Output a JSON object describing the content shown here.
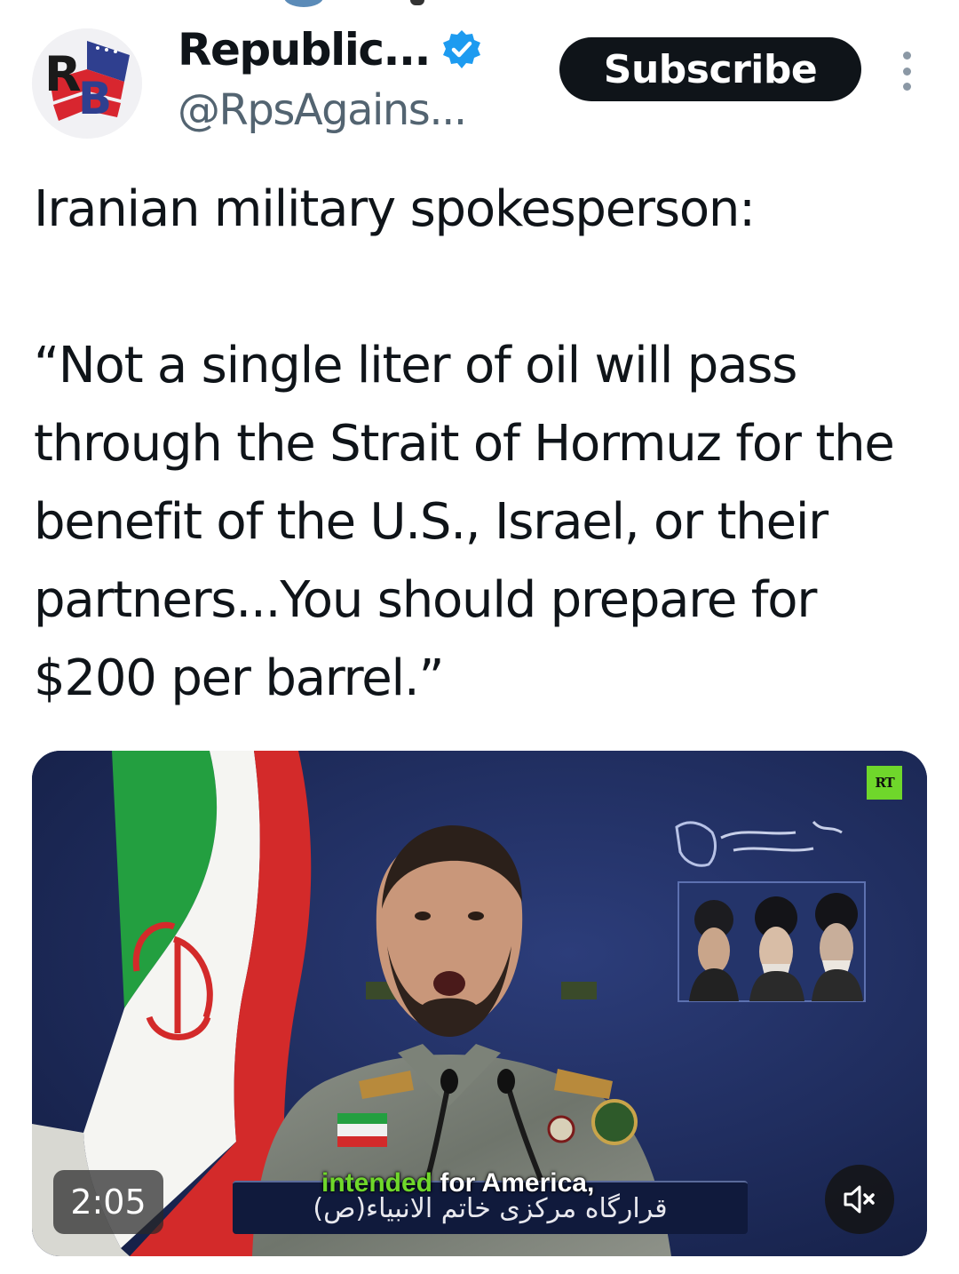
{
  "account": {
    "display_name": "Republic...",
    "handle": "@RpsAgains...",
    "avatar_letters": "RB",
    "subscribe_label": "Subscribe"
  },
  "tweet": {
    "text": "Iranian military spokesperson:\n\n“Not a single liter of oil will pass through the Strait of Hormuz for the benefit of the U.S., Israel, or their partners...You should prepare for $200 per barrel.”"
  },
  "video": {
    "duration": "2:05",
    "channel_logo": "RT",
    "caption_highlight": "intended",
    "caption_rest": " for America,",
    "persian_banner": "قرارگاه مرکزی خاتم الانبیاء(ص)",
    "mute_icon": "volume-muted-icon"
  },
  "colors": {
    "verified_blue": "#1d9bf0",
    "subscribe_bg": "#0f1419",
    "caption_green": "#6fd72b",
    "backdrop": "#1d2a5a"
  }
}
